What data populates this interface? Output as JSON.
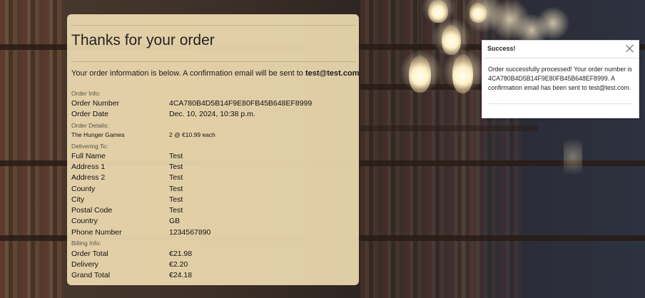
{
  "order": {
    "title": "Thanks for your order",
    "intro_text": "Your order information is below. A confirmation email will be sent to ",
    "email": "test@test.com",
    "intro_end": ".",
    "order_info": {
      "heading": "Order Info:",
      "number_label": "Order Number",
      "number_value": "4CA780B4D5B14F9E80FB45B648EF8999",
      "date_label": "Order Date",
      "date_value": "Dec. 10, 2024, 10:38 p.m."
    },
    "order_details": {
      "heading": "Order Details:",
      "items": [
        {
          "name": "The Hunger Games",
          "qty_price": "2 @ €10.99 each"
        }
      ]
    },
    "delivering_to": {
      "heading": "Delivering To:",
      "rows": [
        {
          "label": "Full Name",
          "value": "Test"
        },
        {
          "label": "Address 1",
          "value": "Test"
        },
        {
          "label": "Address 2",
          "value": "Test"
        },
        {
          "label": "County",
          "value": "Test"
        },
        {
          "label": "City",
          "value": "Test"
        },
        {
          "label": "Postal Code",
          "value": "Test"
        },
        {
          "label": "Country",
          "value": "GB"
        },
        {
          "label": "Phone Number",
          "value": "1234567890"
        }
      ]
    },
    "billing_info": {
      "heading": "Billing Info:",
      "rows": [
        {
          "label": "Order Total",
          "value": "€21.98"
        },
        {
          "label": "Delivery",
          "value": "€2.20"
        },
        {
          "label": "Grand Total",
          "value": "€24.18"
        }
      ]
    }
  },
  "toast": {
    "title": "Success!",
    "close_icon": "close-icon",
    "message": "Order successfully processed! Your order number is 4CA780B4D5B14F9E80FB45B648EF8999. A confirmation email has been sent to test@test.com."
  }
}
